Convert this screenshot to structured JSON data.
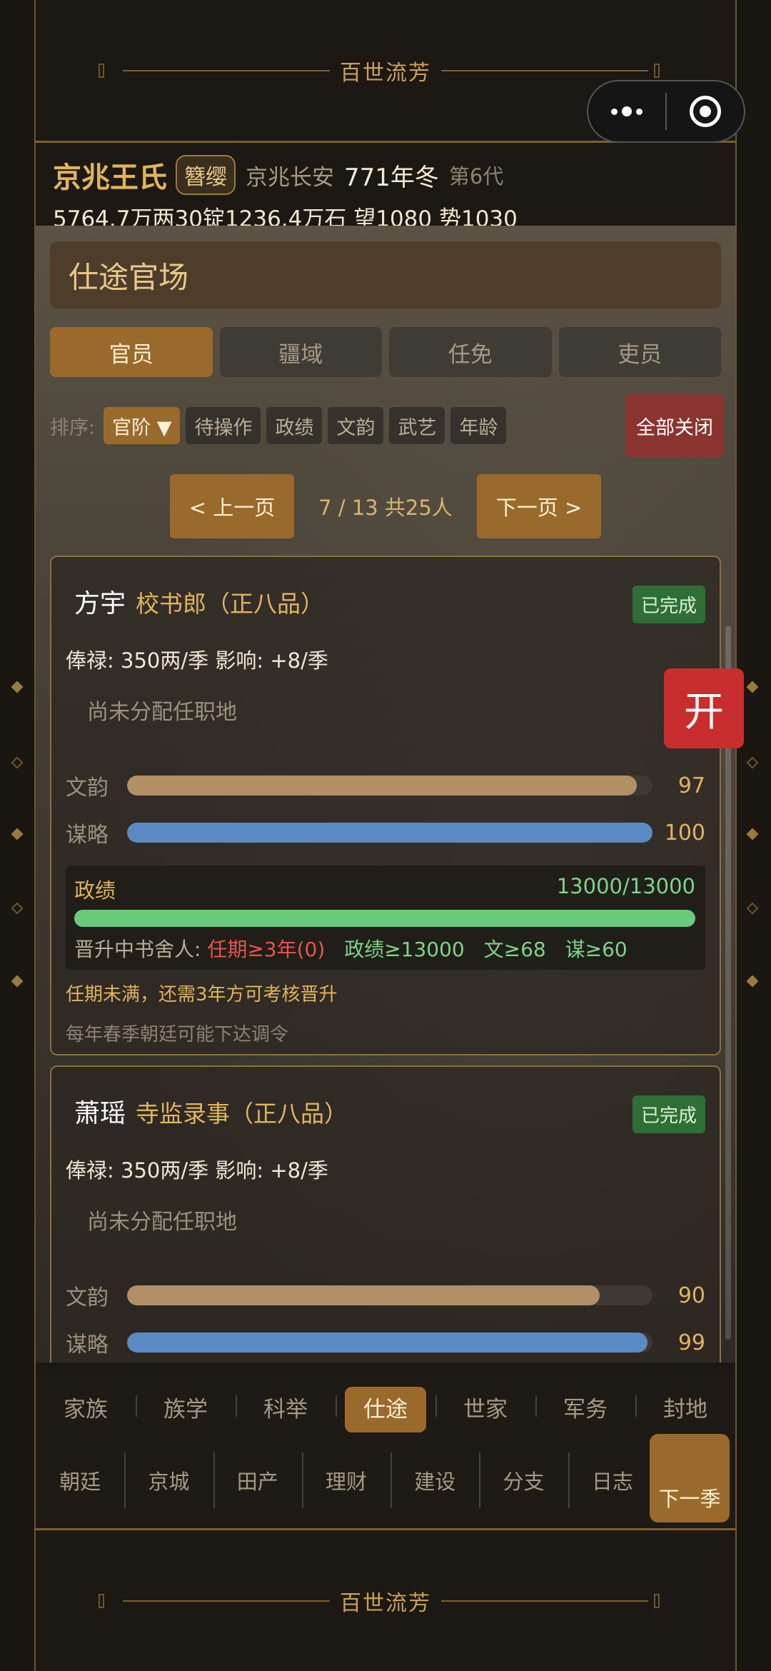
{
  "banner": {
    "title": "百世流芳"
  },
  "header": {
    "clan": "京兆王氏",
    "rank_badge": "簪缨",
    "location": "京兆长安",
    "year": "771年冬",
    "generation": "第6代",
    "resources": "5764.7万两30锭1236.4万石  望1080 势1030"
  },
  "panel": {
    "title": "仕途官场",
    "tabs": [
      {
        "label": "官员",
        "active": true
      },
      {
        "label": "疆域",
        "active": false
      },
      {
        "label": "任免",
        "active": false
      },
      {
        "label": "吏员",
        "active": false
      }
    ],
    "sort_label": "排序:",
    "sort_chips": [
      "官阶 ▼",
      "待操作",
      "政绩",
      "文韵",
      "武艺",
      "年龄"
    ],
    "close_all": "全部关闭",
    "pager": {
      "prev": "< 上一页",
      "info": "7 / 13   共25人",
      "next": "下一页 >"
    }
  },
  "officials": [
    {
      "name": "方宇",
      "post": "校书郎（正八品）",
      "status": "已完成",
      "pay": "俸禄: 350两/季   影响: +8/季",
      "assignment": "尚未分配任职地",
      "stats": [
        {
          "label": "文韵",
          "value": "97",
          "pct": 0.97,
          "color": "tan"
        },
        {
          "label": "谋略",
          "value": "100",
          "pct": 1.0,
          "color": "blue"
        }
      ],
      "merit": {
        "label": "政绩",
        "value": "13000/13000",
        "pct": 1.0,
        "req_prefix": "晋升中书舍人:",
        "req_red": "任期≥3年(0)",
        "req_green": [
          "政绩≥13000",
          "文≥68",
          "谋≥60"
        ]
      },
      "note1": "任期未满，还需3年方可考核晋升",
      "note2": "每年春季朝廷可能下达调令"
    },
    {
      "name": "萧瑶",
      "post": "寺监录事（正八品）",
      "status": "已完成",
      "pay": "俸禄: 350两/季   影响: +8/季",
      "assignment": "尚未分配任职地",
      "stats": [
        {
          "label": "文韵",
          "value": "90",
          "pct": 0.9,
          "color": "tan"
        },
        {
          "label": "谋略",
          "value": "99",
          "pct": 0.99,
          "color": "blue"
        }
      ]
    }
  ],
  "open_button": "开",
  "nav_primary": [
    {
      "label": "家族",
      "active": false
    },
    {
      "label": "族学",
      "active": false
    },
    {
      "label": "科举",
      "active": false
    },
    {
      "label": "仕途",
      "active": true
    },
    {
      "label": "世家",
      "active": false
    },
    {
      "label": "军务",
      "active": false
    },
    {
      "label": "封地",
      "active": false
    }
  ],
  "nav_secondary": [
    "朝廷",
    "京城",
    "田产",
    "理财",
    "建设",
    "分支",
    "日志"
  ],
  "next_season": "下一季"
}
